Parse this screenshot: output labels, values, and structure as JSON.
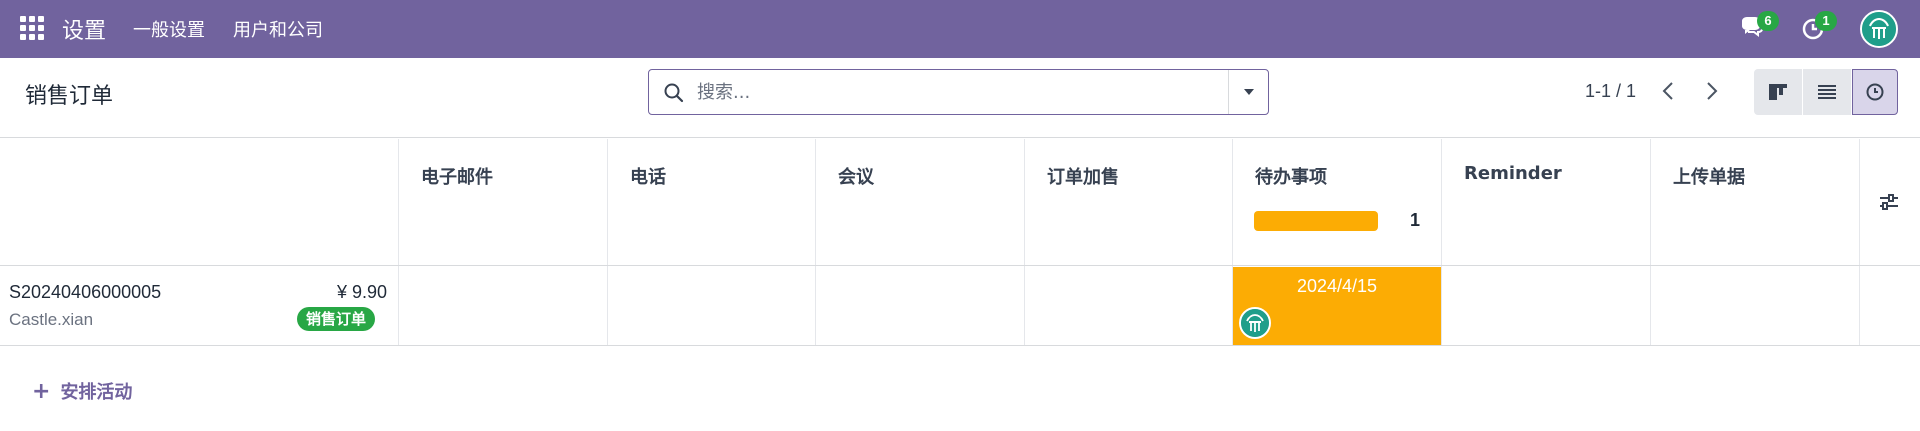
{
  "navbar": {
    "brand": "设置",
    "menu": [
      "一般设置",
      "用户和公司"
    ],
    "messages_count": "6",
    "activities_count": "1"
  },
  "control_panel": {
    "title": "销售订单",
    "search": {
      "placeholder": "搜索..."
    },
    "pager": "1-1 / 1"
  },
  "table": {
    "columns": [
      "电子邮件",
      "电话",
      "会议",
      "订单加售",
      "待办事项",
      "Reminder",
      "上传单据"
    ],
    "todo_count": "1",
    "todo_progress": 1.0,
    "rows": [
      {
        "ref": "S20240406000005",
        "amount": "¥ 9.90",
        "customer": "Castle.xian",
        "status": "销售订单",
        "todo_date": "2024/4/15"
      }
    ]
  },
  "footer": {
    "schedule_label": "安排活动"
  },
  "colors": {
    "navbar": "#71639e",
    "todo": "#fcac04",
    "badge": "#28a745"
  },
  "icons": [
    "apps-icon",
    "chat-icon",
    "clock-icon",
    "search-icon",
    "chevron-down-icon",
    "chevron-left-icon",
    "chevron-right-icon",
    "kanban-icon",
    "list-icon",
    "activity-icon",
    "sliders-icon",
    "plus-icon"
  ]
}
